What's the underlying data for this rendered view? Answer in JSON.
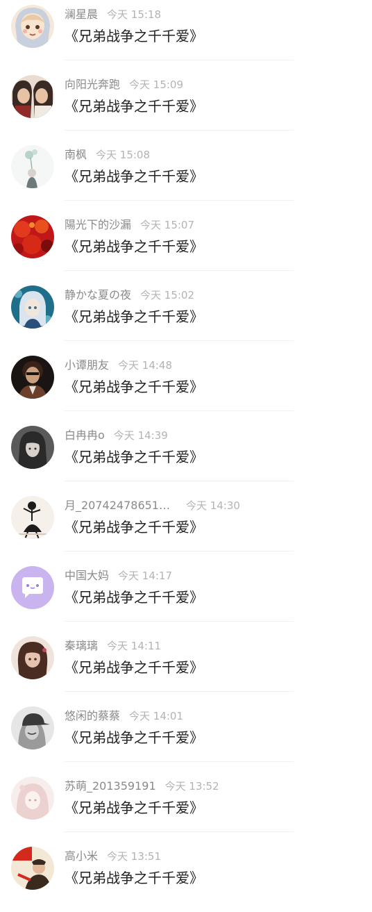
{
  "comments": [
    {
      "user": "澜星晨",
      "time": "今天 15:18",
      "text": "《兄弟战争之千千爱》",
      "avatar_icon": "cartoon-girl-avatar-icon",
      "avatar_colors": [
        "#f6e9dc",
        "#e9c9a7",
        "#c7d0dc"
      ]
    },
    {
      "user": "向阳光奔跑",
      "time": "今天 15:09",
      "text": "《兄弟战争之千千爱》",
      "avatar_icon": "anime-couple-avatar-icon",
      "avatar_colors": [
        "#3a2a24",
        "#d9b59a",
        "#8f2b2b"
      ]
    },
    {
      "user": "南枫",
      "time": "今天 15:08",
      "text": "《兄弟战争之千千爱》",
      "avatar_icon": "flower-sketch-avatar-icon",
      "avatar_colors": [
        "#f4f7f5",
        "#a9c9c0",
        "#6c7a7a"
      ]
    },
    {
      "user": "陽光下的沙漏",
      "time": "今天 15:07",
      "text": "《兄弟战争之千千爱》",
      "avatar_icon": "red-flowers-avatar-icon",
      "avatar_colors": [
        "#c01818",
        "#e23a1e",
        "#7a0c0c"
      ]
    },
    {
      "user": "静かな夏の夜",
      "time": "今天 15:02",
      "text": "《兄弟战争之千千爱》",
      "avatar_icon": "anime-girl-blue-avatar-icon",
      "avatar_colors": [
        "#1f6e8a",
        "#7cc6d8",
        "#f2e6da"
      ]
    },
    {
      "user": "小谭朋友",
      "time": "今天 14:48",
      "text": "《兄弟战争之千千爱》",
      "avatar_icon": "dark-portrait-avatar-icon",
      "avatar_colors": [
        "#1a1412",
        "#6b3f2a",
        "#c9a07f"
      ]
    },
    {
      "user": "白冉冉o",
      "time": "今天 14:39",
      "text": "《兄弟战争之千千爱》",
      "avatar_icon": "girl-bw-portrait-avatar-icon",
      "avatar_colors": [
        "#2a2a2a",
        "#8a8a8a",
        "#d8d0ca"
      ]
    },
    {
      "user": "月_20742478651…",
      "time": "今天 14:30",
      "text": "《兄弟战争之千千爱》",
      "avatar_icon": "dancer-sketch-avatar-icon",
      "avatar_colors": [
        "#f5f0ea",
        "#1c1c1c",
        "#d6c8b8"
      ]
    },
    {
      "user": "中国大妈",
      "time": "今天 14:17",
      "text": "《兄弟战争之千千爱》",
      "avatar_icon": "chat-bubble-avatar-icon",
      "avatar_colors": [
        "#c9b4f0",
        "#ffffff",
        "#9b7fd8"
      ]
    },
    {
      "user": "秦璃璃",
      "time": "今天 14:11",
      "text": "《兄弟战争之千千爱》",
      "avatar_icon": "anime-girl-brown-avatar-icon",
      "avatar_colors": [
        "#4a2c22",
        "#e8c2b0",
        "#c3485a"
      ]
    },
    {
      "user": "悠闲的蔡蔡",
      "time": "今天 14:01",
      "text": "《兄弟战争之千千爱》",
      "avatar_icon": "bw-cap-portrait-avatar-icon",
      "avatar_colors": [
        "#e6e6e6",
        "#3a3a3a",
        "#9a9a9a"
      ]
    },
    {
      "user": "苏萌_201359191",
      "time": "今天 13:52",
      "text": "《兄弟战争之千千爱》",
      "avatar_icon": "pale-illustration-avatar-icon",
      "avatar_colors": [
        "#f7eded",
        "#e8c9c9",
        "#c9a3a3"
      ]
    },
    {
      "user": "高小米",
      "time": "今天 13:51",
      "text": "《兄弟战争之千千爱》",
      "avatar_icon": "red-illustration-avatar-icon",
      "avatar_colors": [
        "#f3e7d6",
        "#d42a1e",
        "#3a2a1e"
      ]
    }
  ]
}
